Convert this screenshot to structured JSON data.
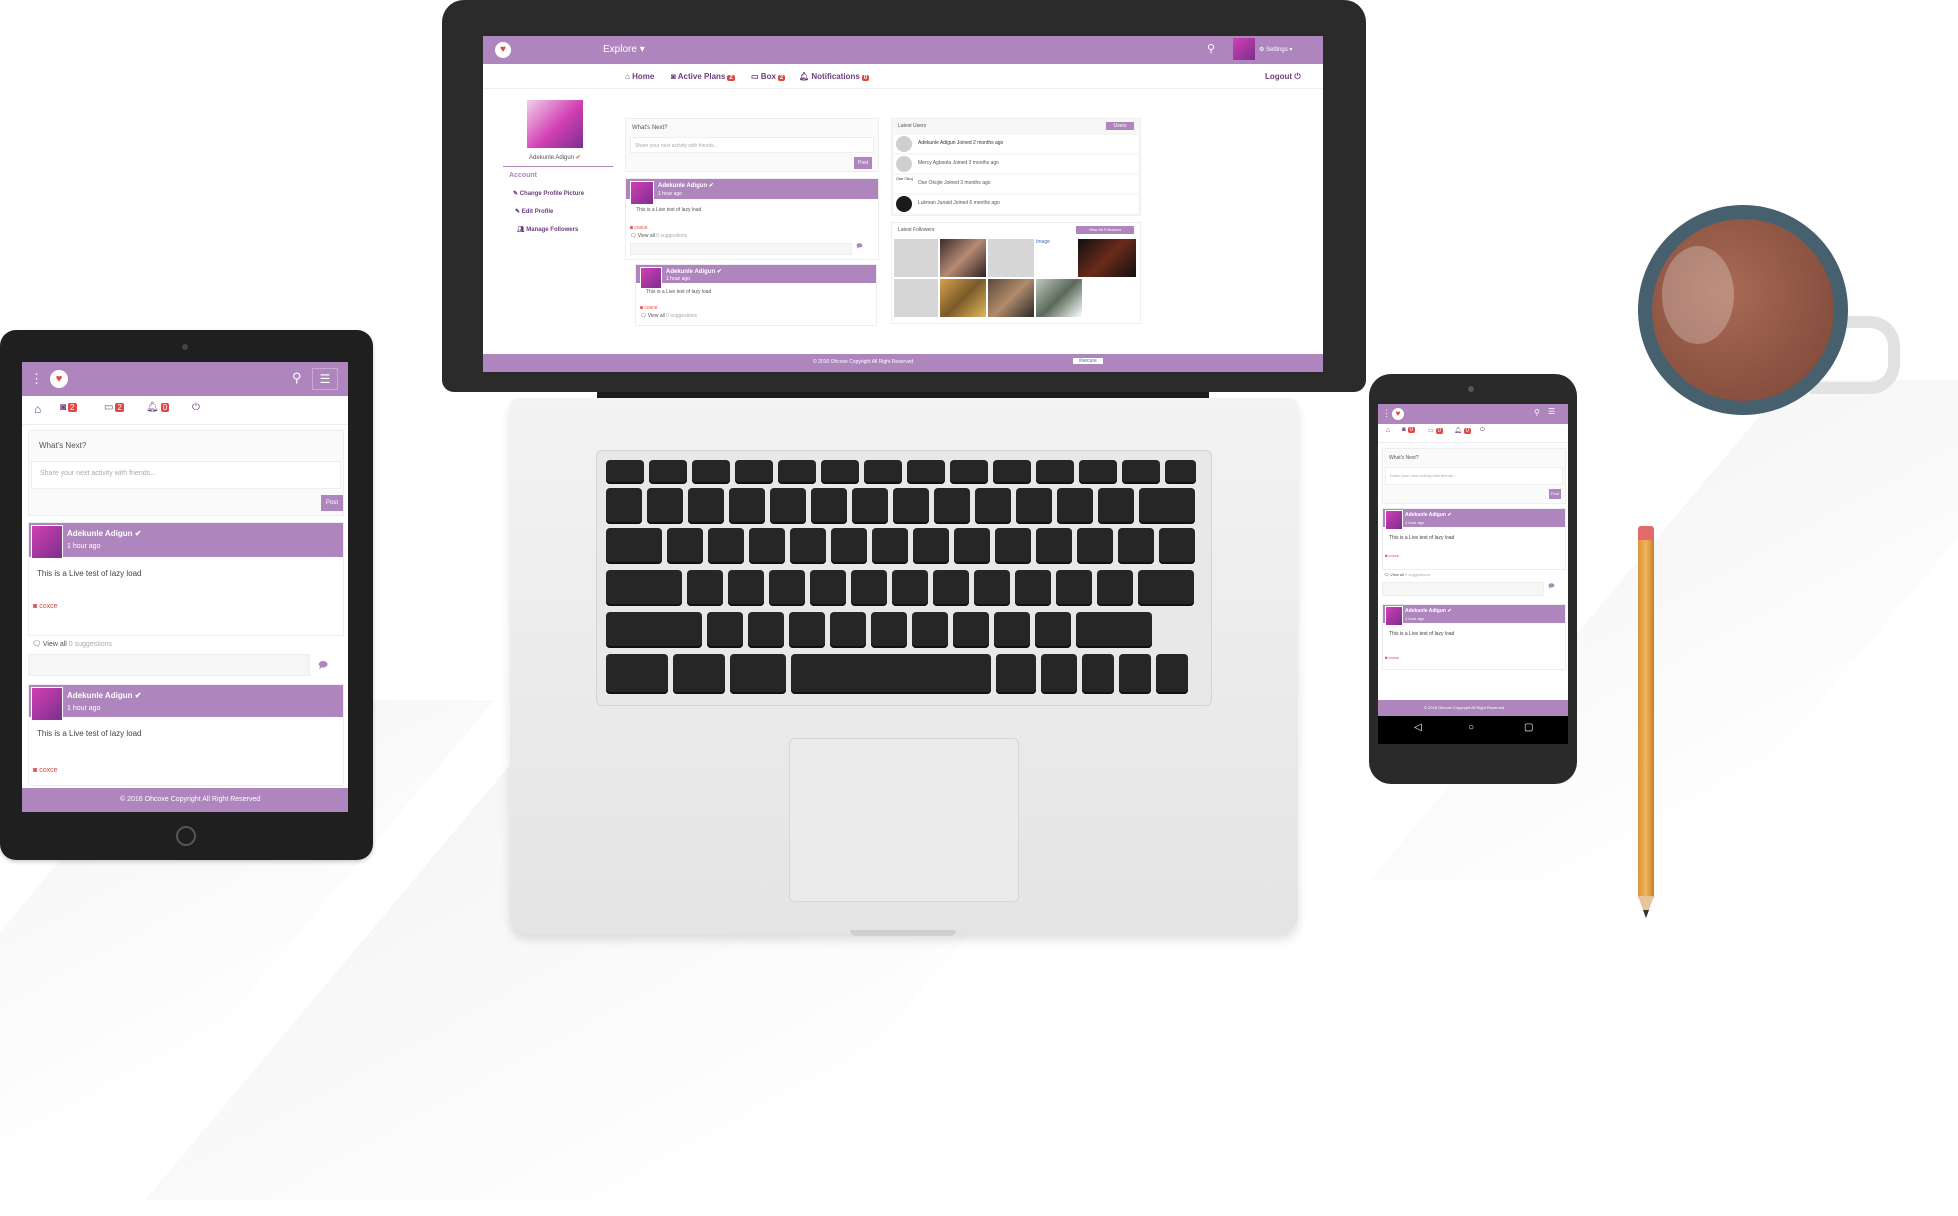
{
  "app": {
    "name": "Ohcoxe",
    "logo_icon": "hearts-logo-icon",
    "accent": "#ae86bd",
    "badge_color": "#e04848"
  },
  "laptop": {
    "top_nav": {
      "explore": "Explore",
      "settings": "Settings"
    },
    "sub_nav": {
      "home": "Home",
      "active_plans": "Active Plans",
      "active_plans_count": "2",
      "box": "Box",
      "box_count": "2",
      "notifications": "Notifications",
      "notifications_count": "0",
      "logout": "Logout"
    },
    "profile": {
      "name": "Adekunle Adigun"
    },
    "account_menu": {
      "title": "Account",
      "items": [
        "Change Profile Picture",
        "Edit Profile",
        "Manage Followers"
      ]
    },
    "composer": {
      "title": "What's Next?",
      "placeholder": "Share your next activity with friends...",
      "post": "Post"
    },
    "posts": [
      {
        "author": "Adekunle Adigun",
        "time": "1 hour ago",
        "text": "This is a Live test of lazy load",
        "action": "coxce",
        "view_all": "View all",
        "suggestions": "0 suggestions"
      },
      {
        "author": "Adekunle Adigun",
        "time": "1 hour ago",
        "text": "This is a Live test of lazy load",
        "action": "coxce",
        "view_all": "View all",
        "suggestions": "0 suggestions"
      }
    ],
    "latest_users": {
      "title": "Latest Users",
      "button": "Users",
      "items": [
        {
          "text": "Adekunle Adigun Joined 2 months ago"
        },
        {
          "text": "Mercy Agboola Joined 3 months ago"
        },
        {
          "text": "Ose Okojie Joined 3 months ago",
          "alt": "Ose Okoj"
        },
        {
          "text": "Lukman Junaid Joined 6 months ago"
        }
      ]
    },
    "latest_followers": {
      "title": "Latest Followers",
      "button": "View All Followers",
      "broken_image": "Image"
    },
    "footer": "© 2016 Ohcoxe Copyright All Right Reserved",
    "footer_tag": "#secure"
  },
  "tablet": {
    "badges": [
      "2",
      "2",
      "0"
    ],
    "composer": {
      "title": "What's Next?",
      "placeholder": "Share your next activity with friends...",
      "post": "Post"
    },
    "posts": [
      {
        "author": "Adekunle Adigun",
        "time": "1 hour ago",
        "text": "This is a Live test of lazy load",
        "action": "coxce",
        "view_all": "View all",
        "suggestions": "0 suggestions"
      },
      {
        "author": "Adekunle Adigun",
        "time": "1 hour ago",
        "text": "This is a Live test of lazy load",
        "action": "coxce"
      }
    ],
    "footer": "© 2016 Ohcoxe Copyright All Right Reserved"
  },
  "phone": {
    "badges": [
      "0",
      "0",
      "0"
    ],
    "composer": {
      "title": "What's Next?",
      "placeholder": "Share your next activity with friends...",
      "post": "Post"
    },
    "posts": [
      {
        "author": "Adekunle Adigun",
        "time": "1 hour ago",
        "text": "This is a Live test of lazy load",
        "action": "coxce",
        "view_all": "View all",
        "suggestions": "0 suggestions"
      },
      {
        "author": "Adekunle Adigun",
        "time": "1 hour ago",
        "text": "This is a Live test of lazy load",
        "action": "coxce"
      }
    ],
    "footer": "© 2016 Ohcoxe Copyright All Right Reserved"
  }
}
